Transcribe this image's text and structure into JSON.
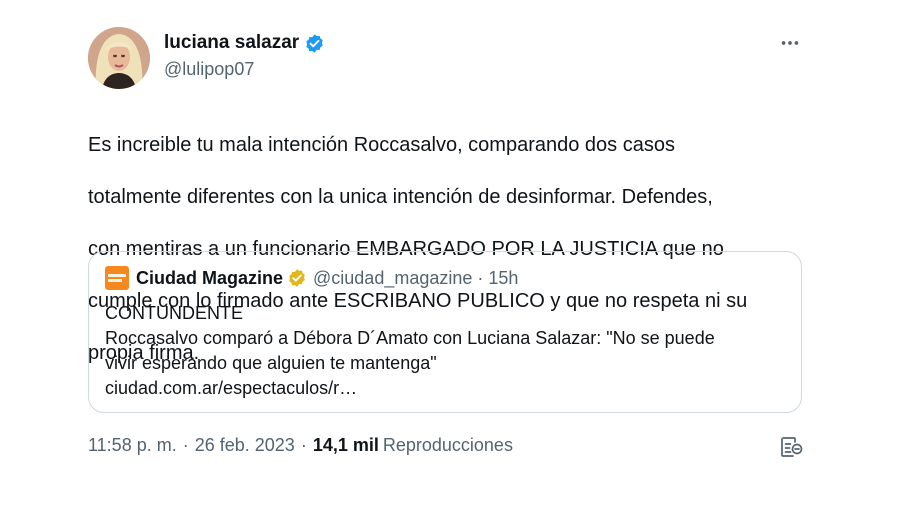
{
  "author": {
    "display_name": "luciana salazar",
    "handle": "@lulipop07",
    "verified_color": "#1d9bf0"
  },
  "more_icon": "more-horizontal-icon",
  "tweet": {
    "line1": "Es increible tu mala intención Roccasalvo, comparando dos casos",
    "line2": "totalmente diferentes con la unica intención de desinformar. Defendes,",
    "line3": "con mentiras a un funcionario EMBARGADO POR LA JUSTICIA que no",
    "line4": "cumple con lo firmado ante ESCRIBANO PUBLICO y que no respeta ni su",
    "line5": "propia firma."
  },
  "quote": {
    "name": "Ciudad Magazine",
    "handle": "@ciudad_magazine",
    "separator": "·",
    "time": "15h",
    "badge_color": "#e2b719",
    "line1": "CONTUNDENTE",
    "line2": "Roccasalvo comparó a Débora D´Amato con Luciana Salazar: \"No se puede",
    "line3": "vivir esperando que alguien te mantenga\"",
    "link": "ciudad.com.ar/espectaculos/r…"
  },
  "meta": {
    "time": "11:58 p. m.",
    "separator": "·",
    "date": "26 feb. 2023",
    "separator2": "·",
    "views_count": "14,1 mil",
    "views_label": "Reproducciones"
  },
  "analytics_icon": "analytics-icon"
}
